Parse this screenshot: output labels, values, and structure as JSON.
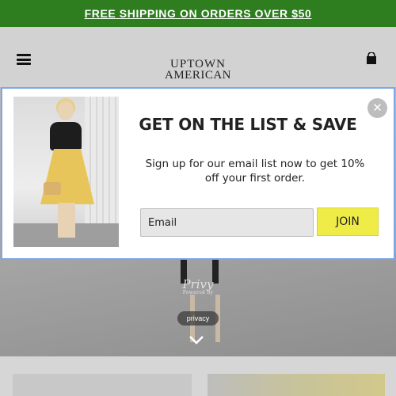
{
  "promo": {
    "text": "FREE SHIPPING ON ORDERS OVER $50"
  },
  "header": {
    "logo_line1": "UPTOWN",
    "logo_line2": "AMERICAN",
    "menu_icon": "hamburger-menu-icon",
    "cart_icon": "shopping-bag-icon"
  },
  "popup": {
    "title": "GET ON THE LIST & SAVE",
    "body": "Sign up for our email list now to get 10% off your first order.",
    "email_placeholder": "Email",
    "join_label": "JOIN",
    "close_icon": "close-icon",
    "image_alt": "woman in black top and yellow skirt"
  },
  "hero": {
    "badge_text": "Privy",
    "badge_sub": "Powered by",
    "privacy_label": "privacy",
    "chevron_icon": "chevron-down-icon"
  },
  "colors": {
    "promo_bg": "#2e7d1f",
    "join_bg": "#f0ec47",
    "modal_border": "#7fa6e6"
  }
}
